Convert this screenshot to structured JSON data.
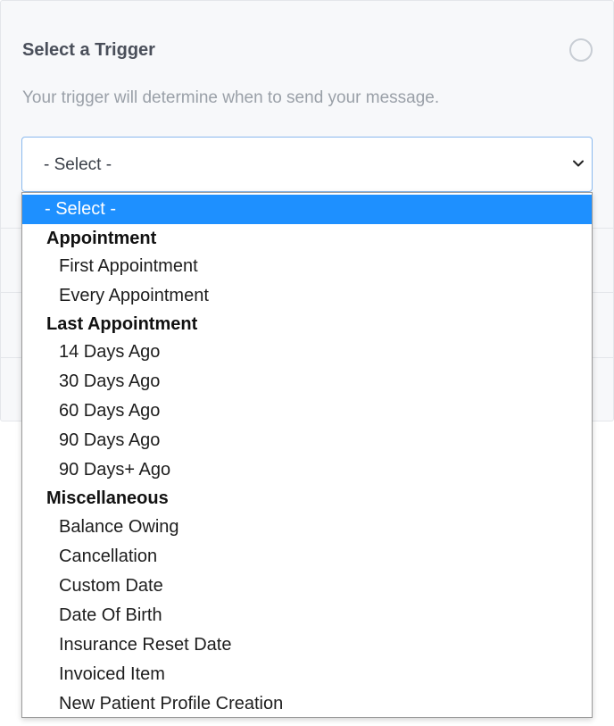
{
  "card": {
    "title": "Select a Trigger",
    "description": "Your trigger will determine when to send your message."
  },
  "select": {
    "value": "- Select -"
  },
  "dropdown": {
    "selected_label": "- Select -",
    "groups": [
      {
        "label": "Appointment",
        "options": [
          "First Appointment",
          "Every Appointment"
        ]
      },
      {
        "label": "Last Appointment",
        "options": [
          "14 Days Ago",
          "30 Days Ago",
          "60 Days Ago",
          "90 Days Ago",
          "90 Days+ Ago"
        ]
      },
      {
        "label": "Miscellaneous",
        "options": [
          "Balance Owing",
          "Cancellation",
          "Custom Date",
          "Date Of Birth",
          "Insurance Reset Date",
          "Invoiced Item",
          "New Patient Profile Creation"
        ]
      }
    ]
  },
  "colors": {
    "highlight": "#1e90ff",
    "select_border": "#8ab9ee",
    "card_bg": "#f7f8fa"
  }
}
